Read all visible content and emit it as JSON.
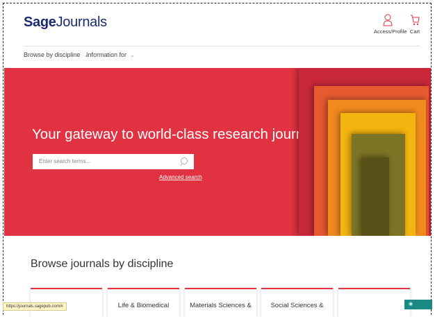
{
  "header": {
    "logo_bold": "Sage",
    "logo_rest": "Journals",
    "access_label": "Access/Profile",
    "cart_label": "Cart"
  },
  "nav": [
    {
      "label": "Browse by discipline"
    },
    {
      "label": "Information for"
    }
  ],
  "hero": {
    "headline": "Your gateway to world-class research journals",
    "search_placeholder": "Enter search terms...",
    "advanced_search": "Advanced search",
    "background_color": "#e13241"
  },
  "browse": {
    "title": "Browse journals by discipline",
    "cards": [
      {
        "label": ""
      },
      {
        "label": "Life & Biomedical"
      },
      {
        "label": "Materials Sciences &"
      },
      {
        "label": "Social Sciences &"
      },
      {
        "label": ""
      }
    ]
  },
  "status_bar": {
    "url": "https://journals.sagepub.com/#"
  },
  "help_button": {
    "icon": "chat-icon"
  }
}
